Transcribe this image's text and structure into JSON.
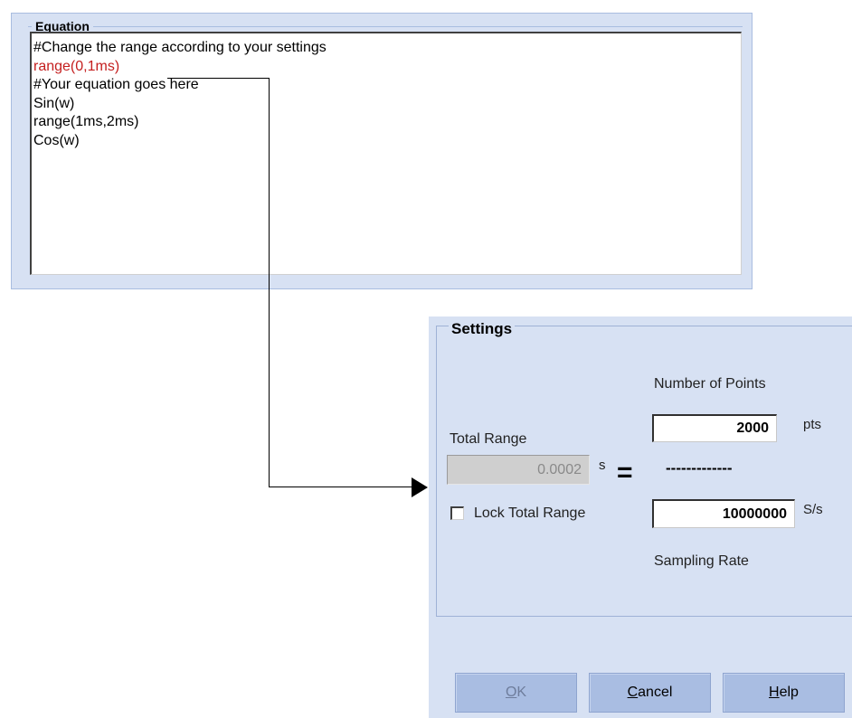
{
  "equation": {
    "title": "Equation",
    "lines": [
      {
        "text": "#Change the range according to your settings",
        "color": "#000000"
      },
      {
        "text": "range(0,1ms)",
        "color": "#c41e1e"
      },
      {
        "text": "#Your equation goes here",
        "color": "#000000"
      },
      {
        "text": "Sin(w)",
        "color": "#000000"
      },
      {
        "text": "range(1ms,2ms)",
        "color": "#000000"
      },
      {
        "text": "Cos(w)",
        "color": "#000000"
      }
    ]
  },
  "settings": {
    "title": "Settings",
    "number_of_points_label": "Number of Points",
    "total_range_label": "Total Range",
    "total_range_value": "0.0002",
    "total_range_unit": "s",
    "equals_symbol": "=",
    "points_value": "2000",
    "points_unit": "pts",
    "divider": "-------------",
    "sampling_rate_value": "10000000",
    "sampling_rate_unit": "S/s",
    "sampling_rate_label": "Sampling Rate",
    "lock_total_range_label": "Lock Total Range",
    "lock_total_range_checked": false
  },
  "buttons": {
    "ok": {
      "first": "O",
      "rest": "K"
    },
    "cancel": {
      "first": "C",
      "rest": "ancel"
    },
    "help": {
      "first": "H",
      "rest": "elp"
    }
  },
  "colors": {
    "panel_background": "#d7e1f3",
    "button_background": "#a9bde2",
    "highlight_text": "#c41e1e"
  }
}
